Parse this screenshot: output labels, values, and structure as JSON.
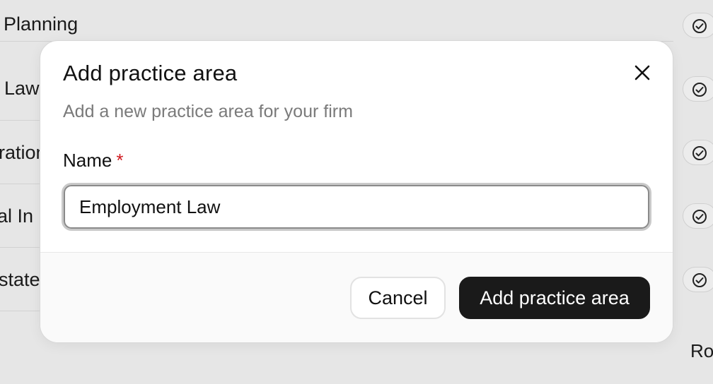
{
  "background": {
    "rows": [
      {
        "label": "Planning"
      },
      {
        "label": "Law"
      },
      {
        "label": "ration"
      },
      {
        "label": "al In"
      },
      {
        "label": "state"
      }
    ],
    "footer_text": "Ro"
  },
  "modal": {
    "title": "Add practice area",
    "subtitle": "Add a new practice area for your firm",
    "name_label": "Name",
    "required_marker": "*",
    "name_value": "Employment Law",
    "cancel_label": "Cancel",
    "submit_label": "Add practice area"
  },
  "icons": {
    "close": "close-icon",
    "row_status": "check-circle-icon"
  },
  "colors": {
    "primary_button": "#1a1a1a",
    "required": "#d0191f",
    "subtitle": "#7a7a7a",
    "backdrop": "#e6e6e6"
  }
}
